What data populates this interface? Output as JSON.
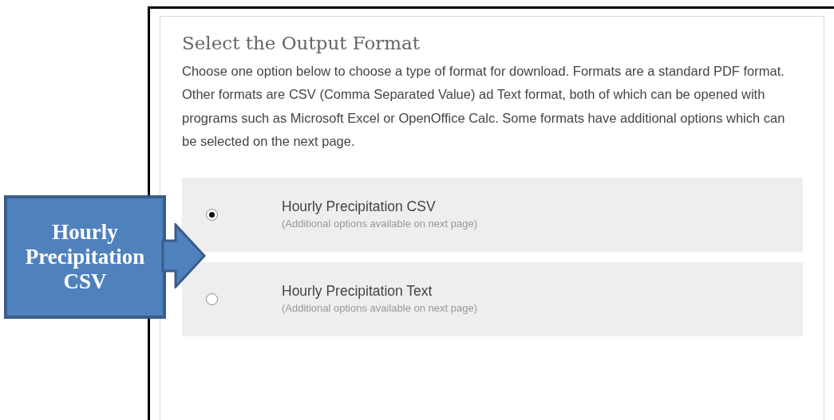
{
  "heading": "Select the Output Format",
  "description": "Choose one option below to choose a type of format for download. Formats are a standard PDF format. Other formats are CSV (Comma Separated Value) ad Text format, both of which can be opened with programs such as Microsoft Excel or OpenOffice Calc. Some formats have additional options which can be selected on the next page.",
  "options": [
    {
      "label": "Hourly Precipitation CSV",
      "note": "(Additional options available on next page)",
      "selected": true
    },
    {
      "label": "Hourly Precipitation Text",
      "note": "(Additional options available on next page)",
      "selected": false
    }
  ],
  "callout": {
    "text": "Hourly Precipitation CSV"
  }
}
